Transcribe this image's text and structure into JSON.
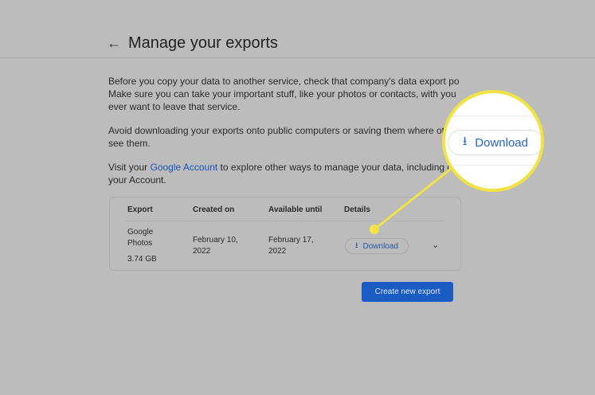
{
  "header": {
    "back_icon": "arrow-left-icon",
    "title": "Manage your exports"
  },
  "intro": {
    "p1_l1": "Before you copy your data to another service, check that company's data export policies.",
    "p1_l2": "Make sure you can take your important stuff, like your photos or contacts, with you if you",
    "p1_l3": "ever want to leave that service.",
    "p2_l1": "Avoid downloading your exports onto public computers or saving them where others can",
    "p2_l2": "see them.",
    "p3_pre": "Visit your ",
    "p3_link": "Google Account",
    "p3_post": " to explore other ways to manage your data, including deleting",
    "p3_l2": "your Account."
  },
  "table": {
    "headers": [
      "Export",
      "Created on",
      "Available until",
      "Details"
    ],
    "rows": [
      {
        "export_l1": "Google",
        "export_l2": "Photos",
        "size": "3.74 GB",
        "created_l1": "February 10,",
        "created_l2": "2022",
        "until_l1": "February 17,",
        "until_l2": "2022",
        "download": "Download"
      }
    ]
  },
  "create_button": "Create new export",
  "magnifier": {
    "download": "Download"
  },
  "colors": {
    "accent": "#1a5bc4",
    "highlight": "#f1e344"
  }
}
